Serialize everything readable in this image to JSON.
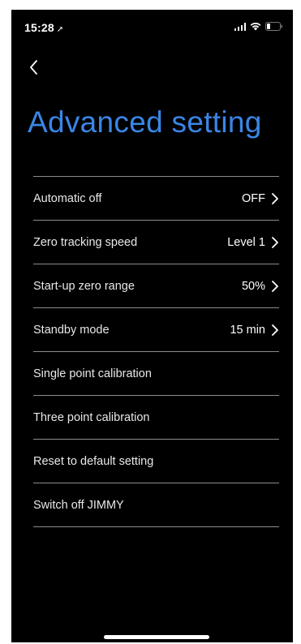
{
  "status_bar": {
    "time": "15:28",
    "location_arrow": "location-arrow-icon"
  },
  "header": {
    "back_icon": "chevron-left-icon",
    "title": "Advanced setting"
  },
  "colors": {
    "title_accent": "#3a86e6",
    "background": "#000000",
    "divider": "#8c8c8c"
  },
  "settings": {
    "rows": [
      {
        "label": "Automatic off",
        "value": "OFF",
        "has_chevron": true
      },
      {
        "label": "Zero tracking speed",
        "value": "Level 1",
        "has_chevron": true
      },
      {
        "label": "Start-up zero range",
        "value": "50%",
        "has_chevron": true
      },
      {
        "label": "Standby mode",
        "value": "15 min",
        "has_chevron": true
      },
      {
        "label": "Single point calibration",
        "value": "",
        "has_chevron": false
      },
      {
        "label": "Three point calibration",
        "value": "",
        "has_chevron": false
      },
      {
        "label": "Reset to default setting",
        "value": "",
        "has_chevron": false
      },
      {
        "label": "Switch off JIMMY",
        "value": "",
        "has_chevron": false
      }
    ]
  }
}
